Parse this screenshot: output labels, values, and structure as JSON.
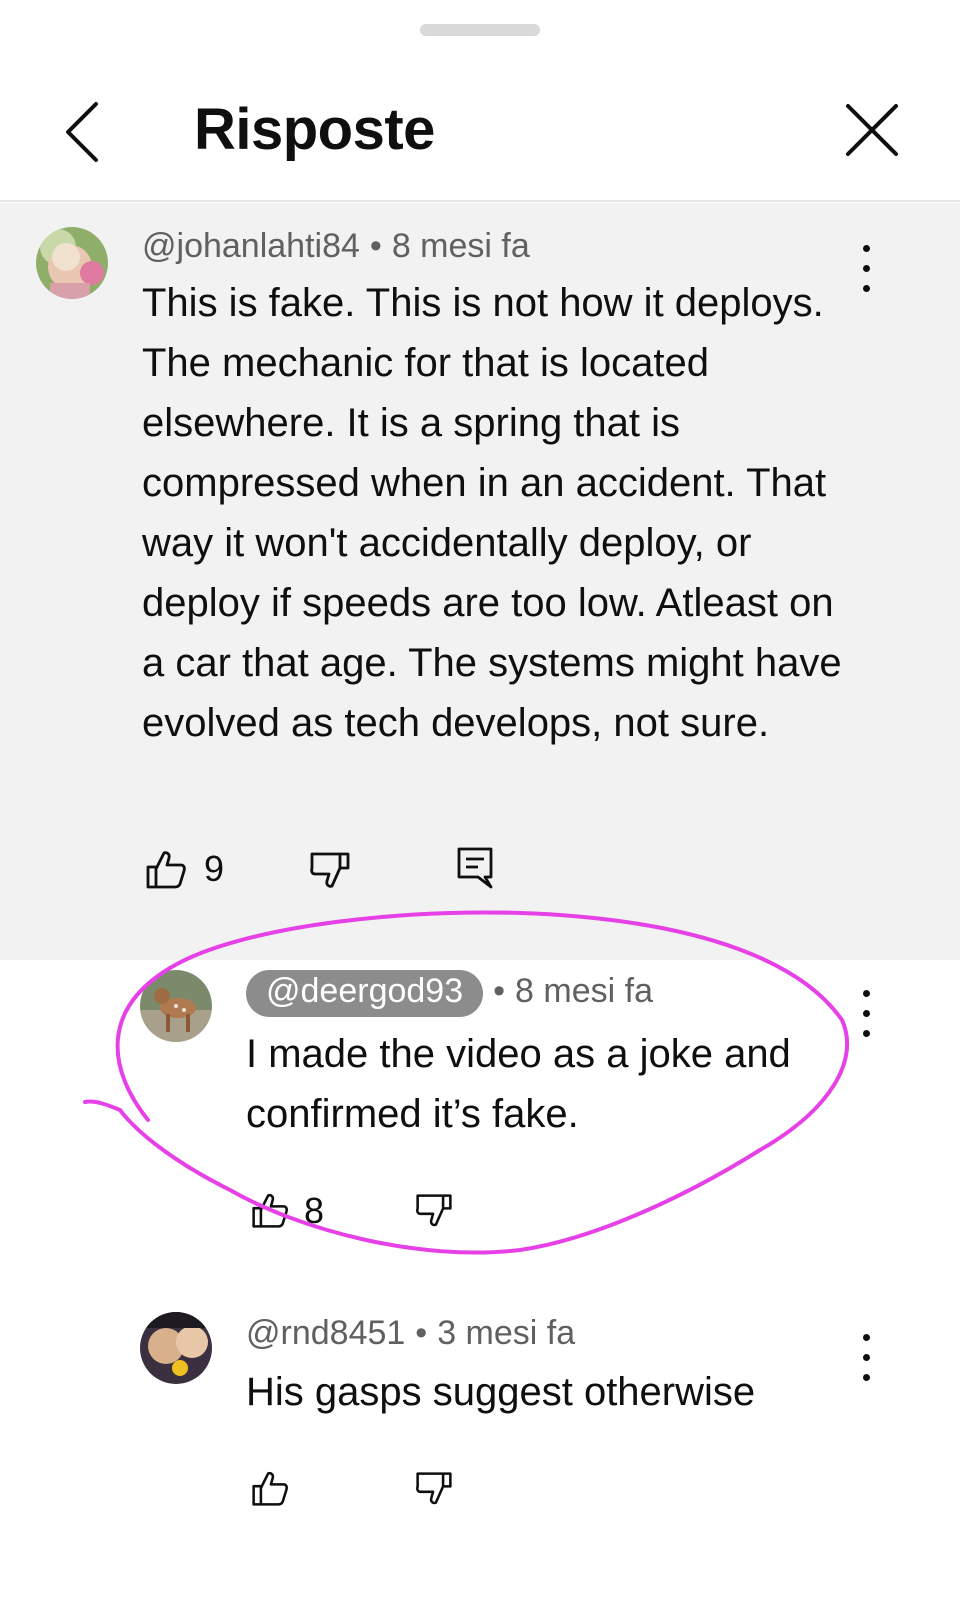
{
  "header": {
    "title": "Risposte",
    "back_icon": "chevron-left-icon",
    "close_icon": "close-icon"
  },
  "parent_comment": {
    "author": "@johanlahti84",
    "time": "8 mesi fa",
    "separator": "•",
    "text": "This is fake. This is not how it deploys. The mechanic for that is located elsewhere. It is a spring that is compressed when in an accident. That way it won't accidentally deploy, or deploy if speeds are too low. Atleast on a car that age. The systems might have evolved as tech develops, not sure.",
    "likes": "9"
  },
  "replies": [
    {
      "author": "@deergod93",
      "time": "8 mesi fa",
      "separator": "•",
      "text": "I made the video as a joke and confirmed it’s fake.",
      "likes": "8"
    },
    {
      "author": "@rnd8451",
      "time": "3 mesi fa",
      "separator": "•",
      "text": "His gasps suggest otherwise",
      "likes": ""
    }
  ],
  "colors": {
    "annotation": "#e641e6",
    "parent_background": "#f2f2f2",
    "handle_pill": "#8c8c8c"
  }
}
